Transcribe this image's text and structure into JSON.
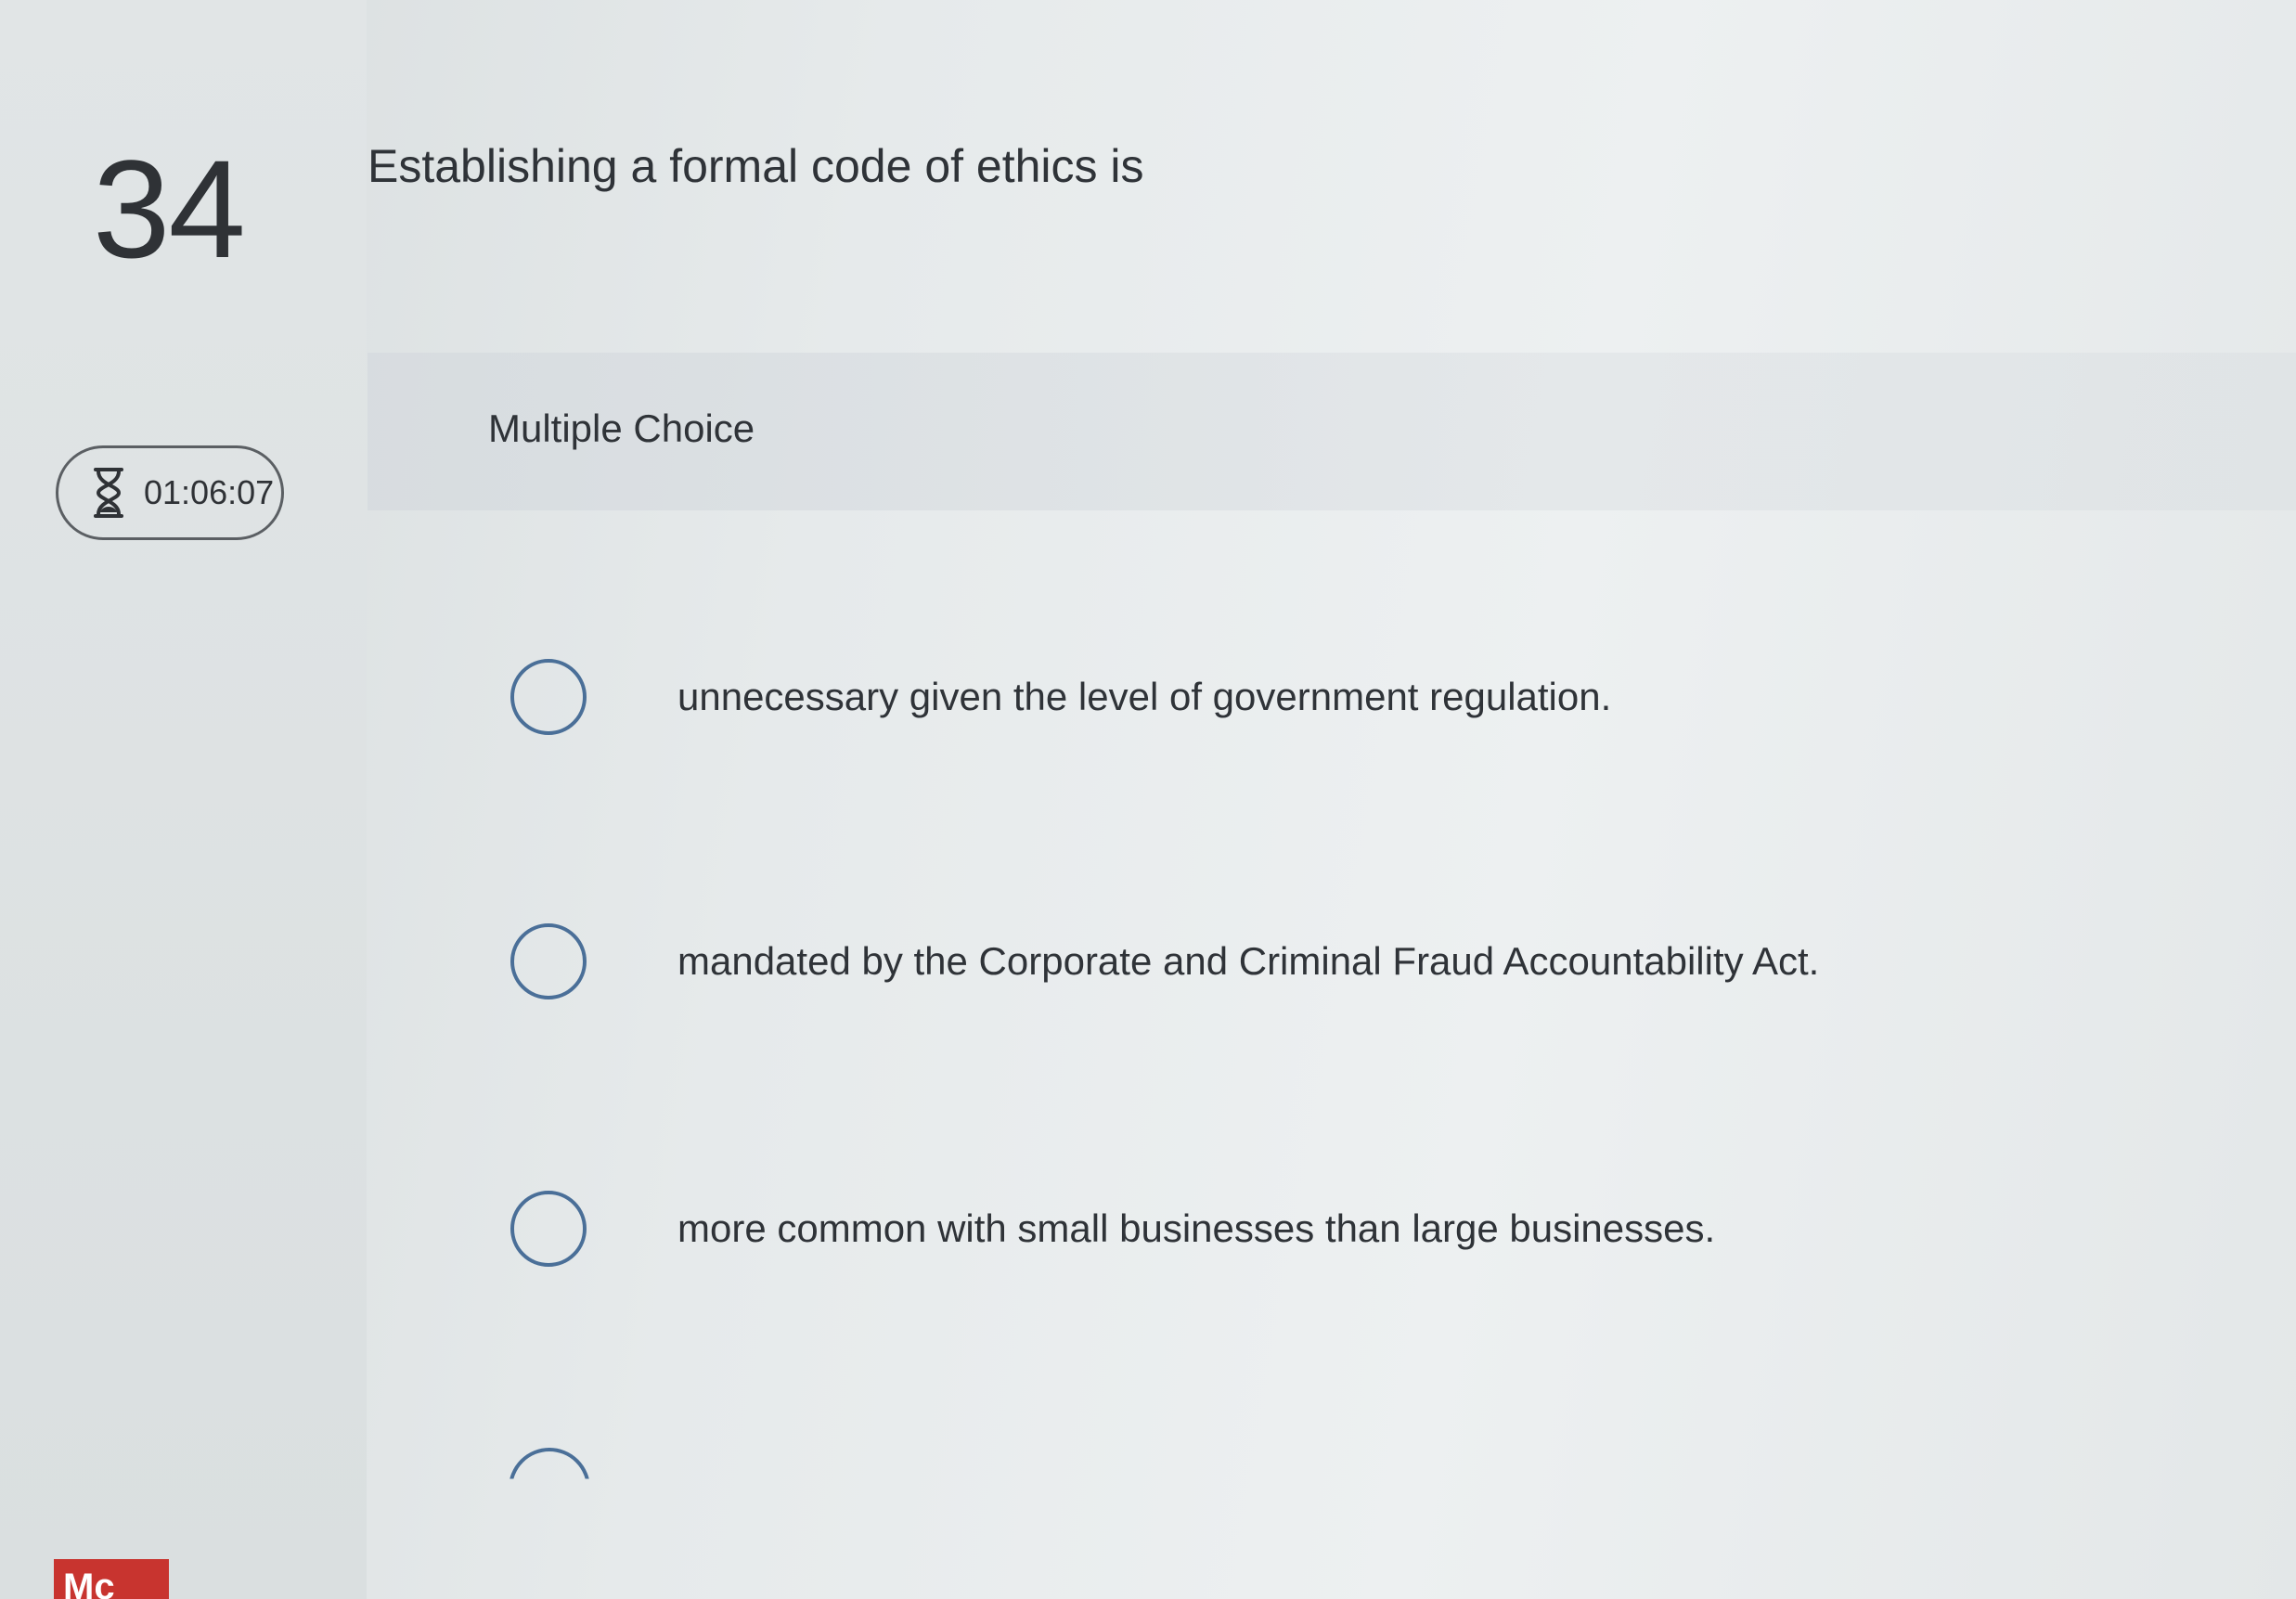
{
  "question": {
    "number": "34",
    "prompt": "Establishing a formal code of ethics is",
    "type": "Multiple Choice"
  },
  "timer": {
    "icon": "hourglass-icon",
    "value": "01:06:07"
  },
  "choices": [
    {
      "label": "unnecessary given the level of government regulation."
    },
    {
      "label": "mandated by the Corporate and Criminal Fraud Accountability Act."
    },
    {
      "label": "more common with small businesses than large businesses."
    }
  ],
  "brand": {
    "logo_text": "Mc",
    "color": "#c8342f"
  },
  "colors": {
    "radio_border": "#4a6f98",
    "text": "#2f3338"
  }
}
